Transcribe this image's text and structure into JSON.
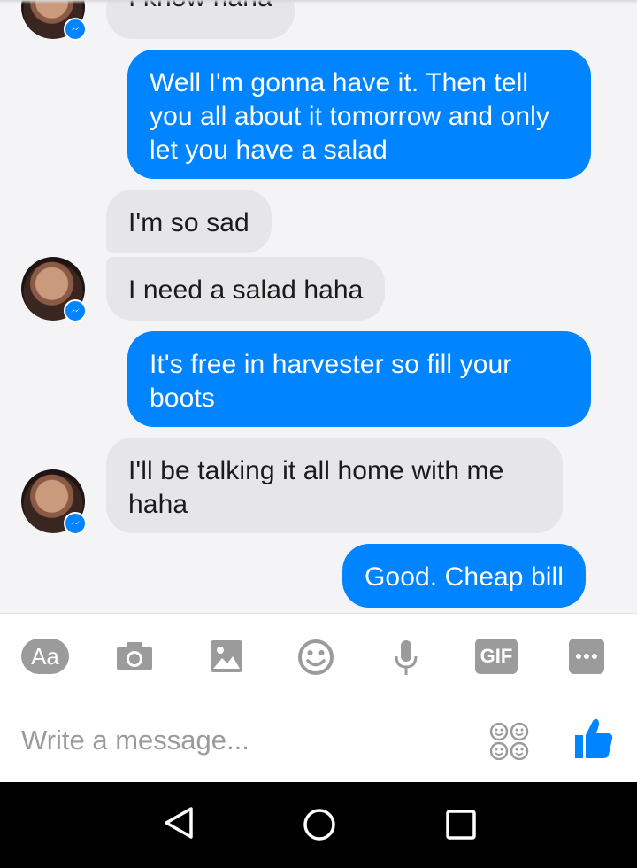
{
  "messages": [
    {
      "side": "in",
      "text": "I know haha"
    },
    {
      "side": "out",
      "text": "Well I'm gonna have it. Then tell you all about it tomorrow and only let you have a salad"
    },
    {
      "side": "in",
      "text": "I'm so sad"
    },
    {
      "side": "in",
      "text": "I need a salad haha"
    },
    {
      "side": "out",
      "text": "It's free in harvester so fill your boots"
    },
    {
      "side": "in",
      "text": "I'll be talking it all home with me haha"
    },
    {
      "side": "out",
      "text": "Good. Cheap bill"
    }
  ],
  "composer": {
    "aa_label": "Aa",
    "gif_label": "GIF",
    "placeholder": "Write a message...",
    "tools": [
      "text-icon",
      "camera-icon",
      "gallery-icon",
      "emoji-icon",
      "microphone-icon",
      "gif-icon",
      "more-icon"
    ]
  },
  "colors": {
    "outgoing": "#0084ff",
    "incoming": "#e6e6e8",
    "icon_gray": "#9b9b9b",
    "like_blue": "#0084ff"
  },
  "navigation": [
    "back-icon",
    "home-icon",
    "recents-icon"
  ]
}
